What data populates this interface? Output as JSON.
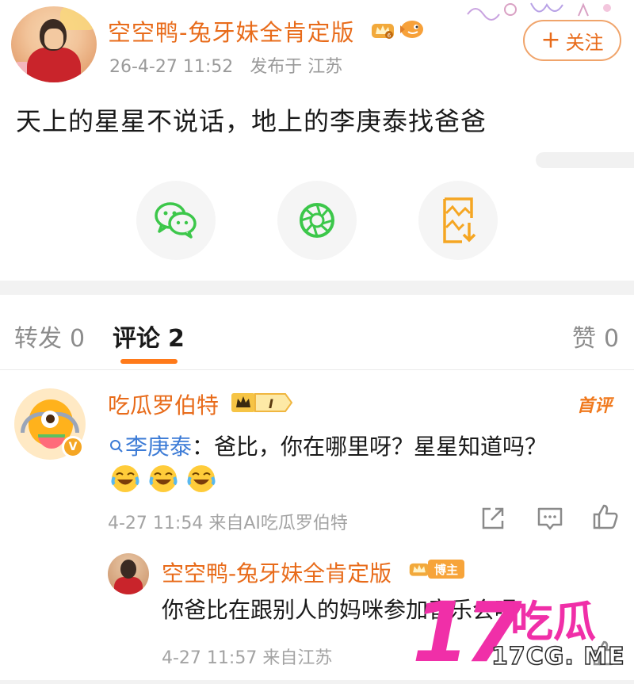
{
  "post": {
    "author": "空空鸭-兔牙妹全肯定版",
    "time": "26-4-27 11:52",
    "location": "发布于 江苏",
    "follow_label": "关注",
    "follow_plus": "+",
    "text": "天上的星星不说话，地上的李庚泰找爸爸"
  },
  "share": {
    "icons": [
      "wechat-icon",
      "moments-icon",
      "save-image-icon"
    ],
    "accent_colors": {
      "wechat": "#3cc74a",
      "moments": "#3cc74a",
      "save": "#f5a623"
    }
  },
  "tabs": {
    "repost": {
      "label": "转发",
      "count": "0"
    },
    "comment": {
      "label": "评论",
      "count": "2"
    },
    "like": {
      "label": "赞",
      "count": "0"
    }
  },
  "comments": [
    {
      "author": "吃瓜罗伯特",
      "vip_level": "I",
      "badge": "首评",
      "mention": "李庚泰",
      "text": "：爸比，你在哪里呀？星星知道吗？",
      "emoji": [
        "laugh-cry-emoji",
        "laugh-cry-emoji",
        "laugh-cry-emoji"
      ],
      "time": "4-27 11:54",
      "source": "来自AI吃瓜罗伯特",
      "verified_mark": "V",
      "replies": [
        {
          "author": "空空鸭-兔牙妹全肯定版",
          "badge": "博主",
          "text": "你爸比在跟别人的妈咪参加音乐会呢",
          "time": "4-27 11:57",
          "source": "来自江苏"
        }
      ]
    }
  ],
  "watermark": {
    "big": "17",
    "cn": "吃瓜",
    "url": "17CG. ME"
  },
  "colors": {
    "brand_orange": "#e86b1a",
    "tab_underline": "#ff7a1a",
    "mention_blue": "#3c7bd6",
    "watermark_pink": "#f02fa8",
    "meta_gray": "#a3a3a3"
  }
}
